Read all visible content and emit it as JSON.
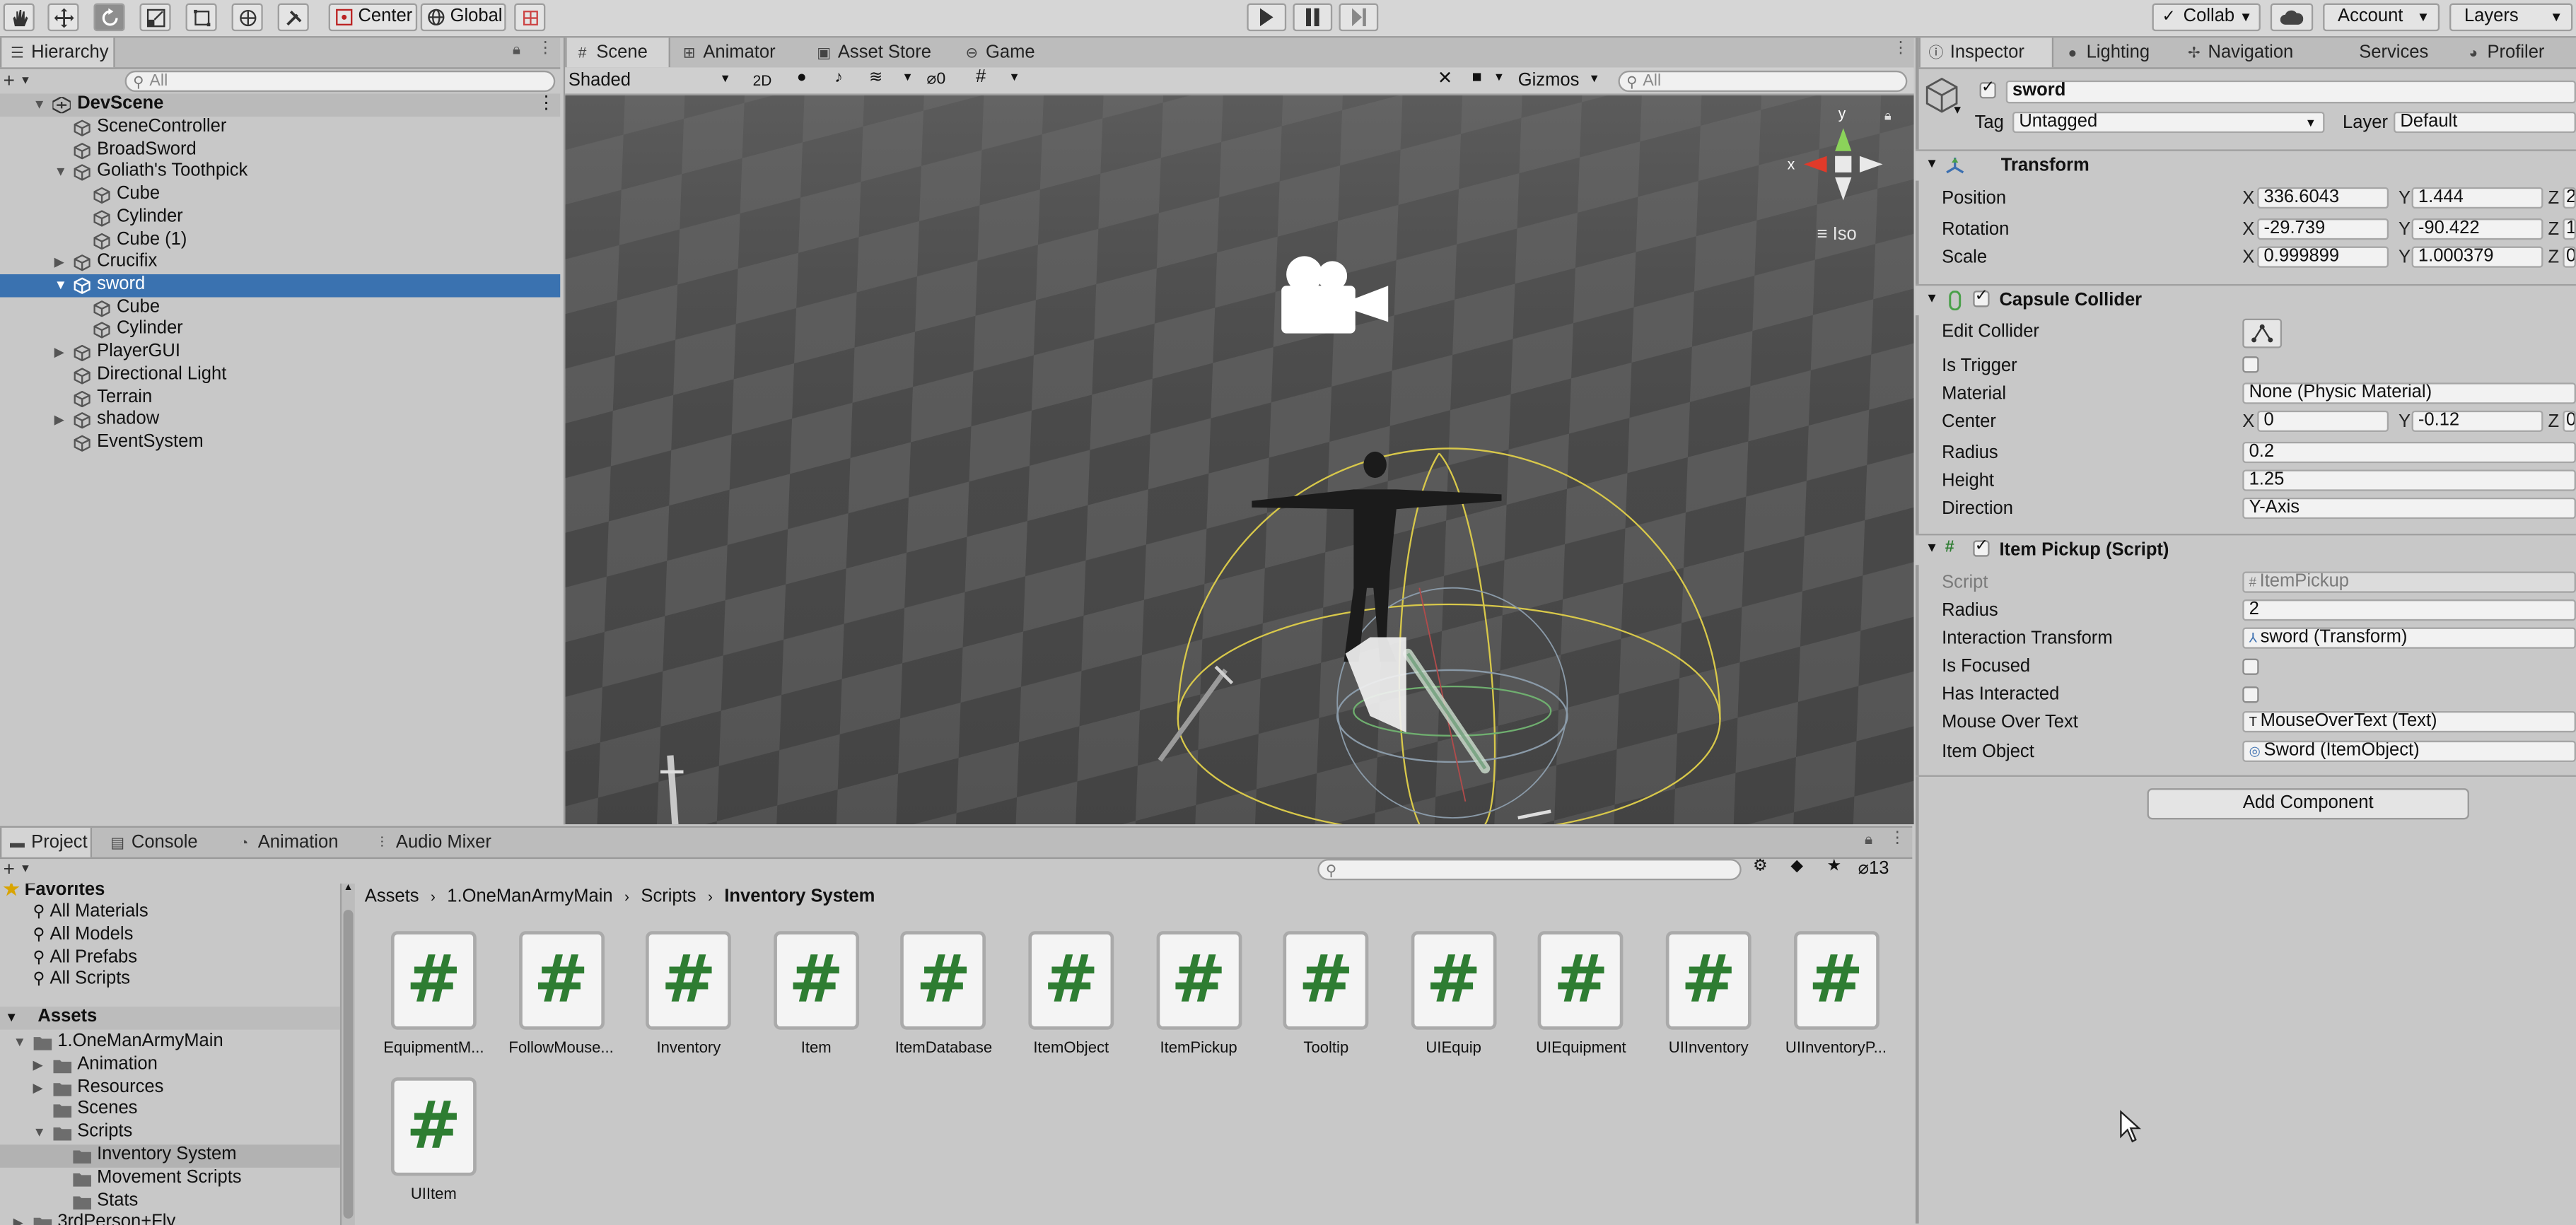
{
  "toolbar": {
    "pivot_center": "Center",
    "pivot_global": "Global",
    "collab": "Collab",
    "account": "Account",
    "layers": "Layers"
  },
  "hierarchy": {
    "tab": "Hierarchy",
    "search_placeholder": "All",
    "scene": "DevScene",
    "items": [
      {
        "label": "SceneController",
        "depth": 1
      },
      {
        "label": "BroadSword",
        "depth": 1
      },
      {
        "label": "Goliath's Toothpick",
        "depth": 1
      },
      {
        "label": "Cube",
        "depth": 2
      },
      {
        "label": "Cylinder",
        "depth": 2
      },
      {
        "label": "Cube (1)",
        "depth": 2
      },
      {
        "label": "Crucifix",
        "depth": 1
      },
      {
        "label": "sword",
        "depth": 1
      },
      {
        "label": "Cube",
        "depth": 2
      },
      {
        "label": "Cylinder",
        "depth": 2
      },
      {
        "label": "PlayerGUI",
        "depth": 1
      },
      {
        "label": "Directional Light",
        "depth": 1
      },
      {
        "label": "Terrain",
        "depth": 1
      },
      {
        "label": "shadow",
        "depth": 1
      },
      {
        "label": "EventSystem",
        "depth": 1
      }
    ]
  },
  "scene_view": {
    "tabs": [
      "Scene",
      "Animator",
      "Asset Store",
      "Game"
    ],
    "shading": "Shaded",
    "mode_2d": "2D",
    "hidden_count": "0",
    "gizmos": "Gizmos",
    "search_placeholder": "All",
    "projection": "Iso",
    "gizmo_x": "x",
    "gizmo_y": "y"
  },
  "inspector": {
    "tabs": [
      "Inspector",
      "Lighting",
      "Navigation",
      "Services",
      "Profiler"
    ],
    "object_name": "sword",
    "tag_label": "Tag",
    "tag_value": "Untagged",
    "layer_label": "Layer",
    "layer_value": "Default",
    "transform": {
      "title": "Transform",
      "position_label": "Position",
      "rotation_label": "Rotation",
      "scale_label": "Scale",
      "position": {
        "x": "336.6043",
        "y": "1.444",
        "z": "2"
      },
      "rotation": {
        "x": "-29.739",
        "y": "-90.422",
        "z": "1"
      },
      "scale": {
        "x": "0.999899",
        "y": "1.000379",
        "z": "0"
      }
    },
    "capsule": {
      "title": "Capsule Collider",
      "edit_collider": "Edit Collider",
      "is_trigger": "Is Trigger",
      "material_label": "Material",
      "material_value": "None (Physic Material)",
      "center_label": "Center",
      "center": {
        "x": "0",
        "y": "-0.12",
        "z": "0"
      },
      "radius_label": "Radius",
      "radius_value": "0.2",
      "height_label": "Height",
      "height_value": "1.25",
      "direction_label": "Direction",
      "direction_value": "Y-Axis"
    },
    "item_pickup": {
      "title": "Item Pickup (Script)",
      "script_label": "Script",
      "script_value": "ItemPickup",
      "radius_label": "Radius",
      "radius_value": "2",
      "interaction_label": "Interaction Transform",
      "interaction_value": "sword (Transform)",
      "is_focused_label": "Is Focused",
      "has_interacted_label": "Has Interacted",
      "mouse_over_label": "Mouse Over Text",
      "mouse_over_value": "MouseOverText (Text)",
      "item_object_label": "Item Object",
      "item_object_value": "Sword (ItemObject)"
    },
    "add_component": "Add Component"
  },
  "project": {
    "tabs": [
      "Project",
      "Console",
      "Animation",
      "Audio Mixer"
    ],
    "count": "13",
    "favorites": "Favorites",
    "fav_items": [
      "All Materials",
      "All Models",
      "All Prefabs",
      "All Scripts"
    ],
    "assets_root": "Assets",
    "tree": [
      {
        "label": "1.OneManArmyMain",
        "depth": 1
      },
      {
        "label": "Animation",
        "depth": 2
      },
      {
        "label": "Resources",
        "depth": 2
      },
      {
        "label": "Scenes",
        "depth": 2
      },
      {
        "label": "Scripts",
        "depth": 2
      },
      {
        "label": "Inventory System",
        "depth": 3
      },
      {
        "label": "Movement Scripts",
        "depth": 3
      },
      {
        "label": "Stats",
        "depth": 3
      },
      {
        "label": "3rdPerson+Fly",
        "depth": 1
      }
    ],
    "breadcrumb": [
      "Assets",
      "1.OneManArmyMain",
      "Scripts",
      "Inventory System"
    ],
    "script_glyph": "#",
    "assets": [
      "EquipmentM...",
      "FollowMouse...",
      "Inventory",
      "Item",
      "ItemDatabase",
      "ItemObject",
      "ItemPickup",
      "Tooltip",
      "UIEquip",
      "UIEquipment",
      "UIInventory",
      "UIInventoryP...",
      "UIItem"
    ]
  },
  "colors": {
    "selection": "#3a72b0",
    "script_hash": "#2e7d32",
    "collider_wire": "#d8c84a"
  }
}
